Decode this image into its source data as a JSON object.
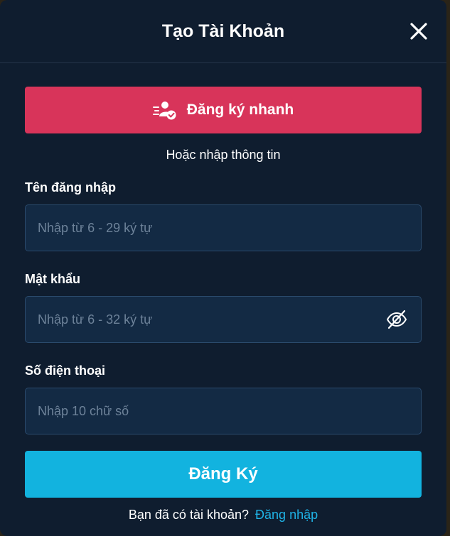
{
  "modal": {
    "title": "Tạo Tài Khoản",
    "close_icon": "close-icon"
  },
  "quick_register": {
    "label": "Đăng ký nhanh",
    "icon": "user-check-icon",
    "color": "#d8345a"
  },
  "divider_text": "Hoặc nhập thông tin",
  "fields": {
    "username": {
      "label": "Tên đăng nhập",
      "placeholder": "Nhập từ 6 - 29 ký tự",
      "value": ""
    },
    "password": {
      "label": "Mật khẩu",
      "placeholder": "Nhập từ 6 - 32 ký tự",
      "value": "",
      "toggle_icon": "eye-off-icon"
    },
    "phone": {
      "label": "Số điện thoại",
      "placeholder": "Nhập 10 chữ số",
      "value": ""
    }
  },
  "submit": {
    "label": "Đăng Ký",
    "color": "#12b3df"
  },
  "footer": {
    "text": "Bạn đã có tài khoản?",
    "link": "Đăng nhập"
  }
}
